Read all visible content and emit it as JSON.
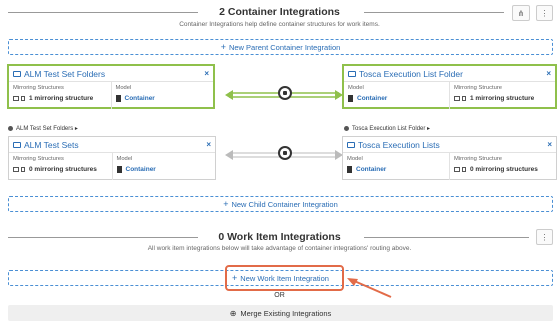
{
  "container_section": {
    "title": "2 Container Integrations",
    "subtitle": "Container Integrations help define container structures for work items.",
    "new_parent_label": "New Parent Container Integration",
    "new_child_label": "New Child Container Integration"
  },
  "parent_left": {
    "title": "ALM Test Set Folders",
    "col1_label": "Mirroring Structures",
    "col1_value": "1 mirroring structure",
    "col2_label": "Model",
    "col2_value": "Container"
  },
  "parent_right": {
    "title": "Tosca Execution List Folder",
    "col1_label": "Model",
    "col1_value": "Container",
    "col2_label": "Mirroring Structure",
    "col2_value": "1 mirroring structure"
  },
  "child_left": {
    "breadcrumb": "ALM Test Set Folders ▸",
    "title": "ALM Test Sets",
    "col1_label": "Mirroring Structures",
    "col1_value": "0 mirroring structures",
    "col2_label": "Model",
    "col2_value": "Container"
  },
  "child_right": {
    "breadcrumb": "Tosca Execution List Folder ▸",
    "title": "Tosca Execution Lists",
    "col1_label": "Model",
    "col1_value": "Container",
    "col2_label": "Mirroring Structure",
    "col2_value": "0 mirroring structures"
  },
  "work_item_section": {
    "title": "0 Work Item Integrations",
    "subtitle": "All work item integrations below will take advantage of container integrations' routing above.",
    "new_label": "New Work Item Integration",
    "or_label": "OR",
    "merge_label": "Merge Existing Integrations"
  },
  "colors": {
    "accent": "#2a6db5",
    "active_border": "#8fc04b",
    "highlight": "#e26b48"
  }
}
